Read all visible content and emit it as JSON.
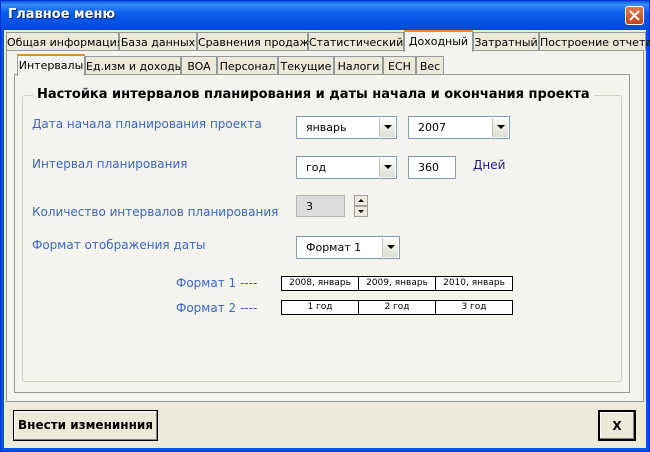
{
  "window": {
    "title": "Главное меню",
    "close_glyph": "✕"
  },
  "tabs_top": [
    {
      "label": "Общая информация"
    },
    {
      "label": "База данных"
    },
    {
      "label": "Сравнения продаж"
    },
    {
      "label": "Статистический"
    },
    {
      "label": "Доходный",
      "active": true
    },
    {
      "label": "Затратный"
    },
    {
      "label": "Построение отчета"
    }
  ],
  "tabs_inner": [
    {
      "label": "Интервалы",
      "active": true
    },
    {
      "label": "Ед.изм и доходы"
    },
    {
      "label": "BOA"
    },
    {
      "label": "Персонал"
    },
    {
      "label": "Текущие"
    },
    {
      "label": "Налоги"
    },
    {
      "label": "ЕСН"
    },
    {
      "label": "Вес"
    }
  ],
  "group": {
    "title": "Настойка интервалов планирования и даты начала и окончания проекта",
    "start_date_label": "Дата начала планирования проекта",
    "start_month": "январь",
    "start_year": "2007",
    "interval_label": "Интервал планирования",
    "interval_unit": "год",
    "interval_days": "360",
    "days_label": "Дней",
    "count_label": "Количество интервалов планирования",
    "count_value": "3",
    "date_format_label": "Формат отображения даты",
    "date_format_value": "Формат 1",
    "format1_label": "Формат 1 ----",
    "format1_cells": [
      "2008, январь",
      "2009, январь",
      "2010, январь"
    ],
    "format2_label": "Формат 2 ----",
    "format2_cells": [
      "1 год",
      "2 год",
      "3 год"
    ]
  },
  "buttons": {
    "apply": "Внести изменинния",
    "close": "X"
  },
  "colors": {
    "title_bar": "#0054e3",
    "label_blue": "#3b67c2",
    "face": "#ece9d8"
  }
}
